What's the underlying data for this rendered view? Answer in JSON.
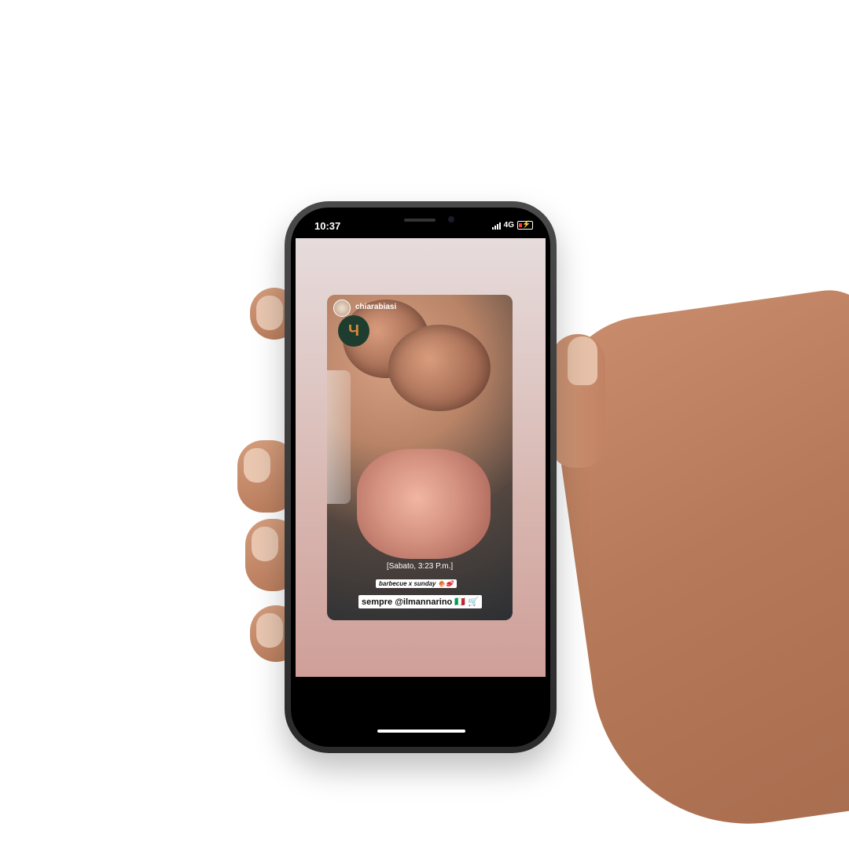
{
  "status_bar": {
    "time": "10:37",
    "network": "4G"
  },
  "story": {
    "username": "chiarabiasi",
    "brand_logo_text": "Ч",
    "caption_date": "[Sabato, 3:23 P.m.]",
    "caption_bbq": "barbecue x sunday 🍖🥩",
    "caption_sempre": "sempre @ilmannarino 🇮🇹 🛒"
  },
  "colors": {
    "screen_top": "#e6dcdc",
    "screen_bottom": "#cf9f98",
    "logo_bg": "#1e3d2f",
    "logo_fg": "#d8893d"
  },
  "icons": [
    "signal-icon",
    "battery-icon",
    "avatar",
    "brand-logo"
  ]
}
